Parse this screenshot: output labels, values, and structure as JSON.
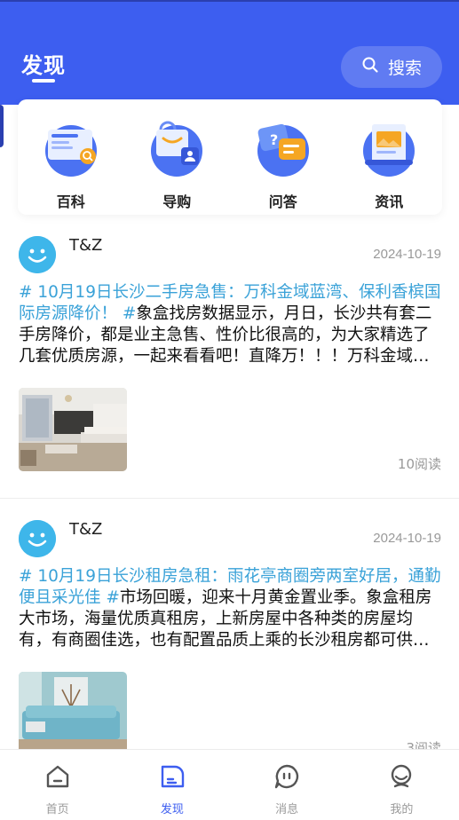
{
  "header": {
    "title": "发现",
    "search_label": "搜索"
  },
  "categories": [
    {
      "label": "百科",
      "icon": "encyclopedia-icon"
    },
    {
      "label": "导购",
      "icon": "shopping-guide-icon"
    },
    {
      "label": "问答",
      "icon": "qa-icon"
    },
    {
      "label": "资讯",
      "icon": "news-icon"
    }
  ],
  "posts": [
    {
      "author": "T&Z",
      "date": "2024-10-19",
      "topic": "# 10月19日长沙二手房急售：万科金域蓝湾、保利香槟国际房源降价！ #",
      "text": "象盒找房数据显示，月日，长沙共有套二手房降价，都是业主急售、性价比很高的，为大家精选了几套优质房源，一起来看看吧！直降万！！！万科金域蓝湾室厅卫万房源亮点：精装…",
      "reads": "10阅读"
    },
    {
      "author": "T&Z",
      "date": "2024-10-19",
      "topic": "# 10月19日长沙租房急租：雨花亭商圈旁两室好居，通勤便且采光佳 #",
      "text": "市场回暖，迎来十月黄金置业季。象盒租房大市场，海量优质真租房，上新房屋中各种类的房屋均有，有商圈佳选，也有配置品质上乘的长沙租房都可供选择。每日急出热推租房有小户…",
      "reads": "3阅读"
    }
  ],
  "tabbar": {
    "items": [
      {
        "label": "首页",
        "icon": "home-icon"
      },
      {
        "label": "发现",
        "icon": "discover-icon"
      },
      {
        "label": "消息",
        "icon": "message-icon"
      },
      {
        "label": "我的",
        "icon": "profile-icon"
      }
    ],
    "active": "发现"
  },
  "colors": {
    "primary": "#3d5ef0",
    "topic": "#3aa2d8",
    "avatar": "#3eb6ea"
  }
}
